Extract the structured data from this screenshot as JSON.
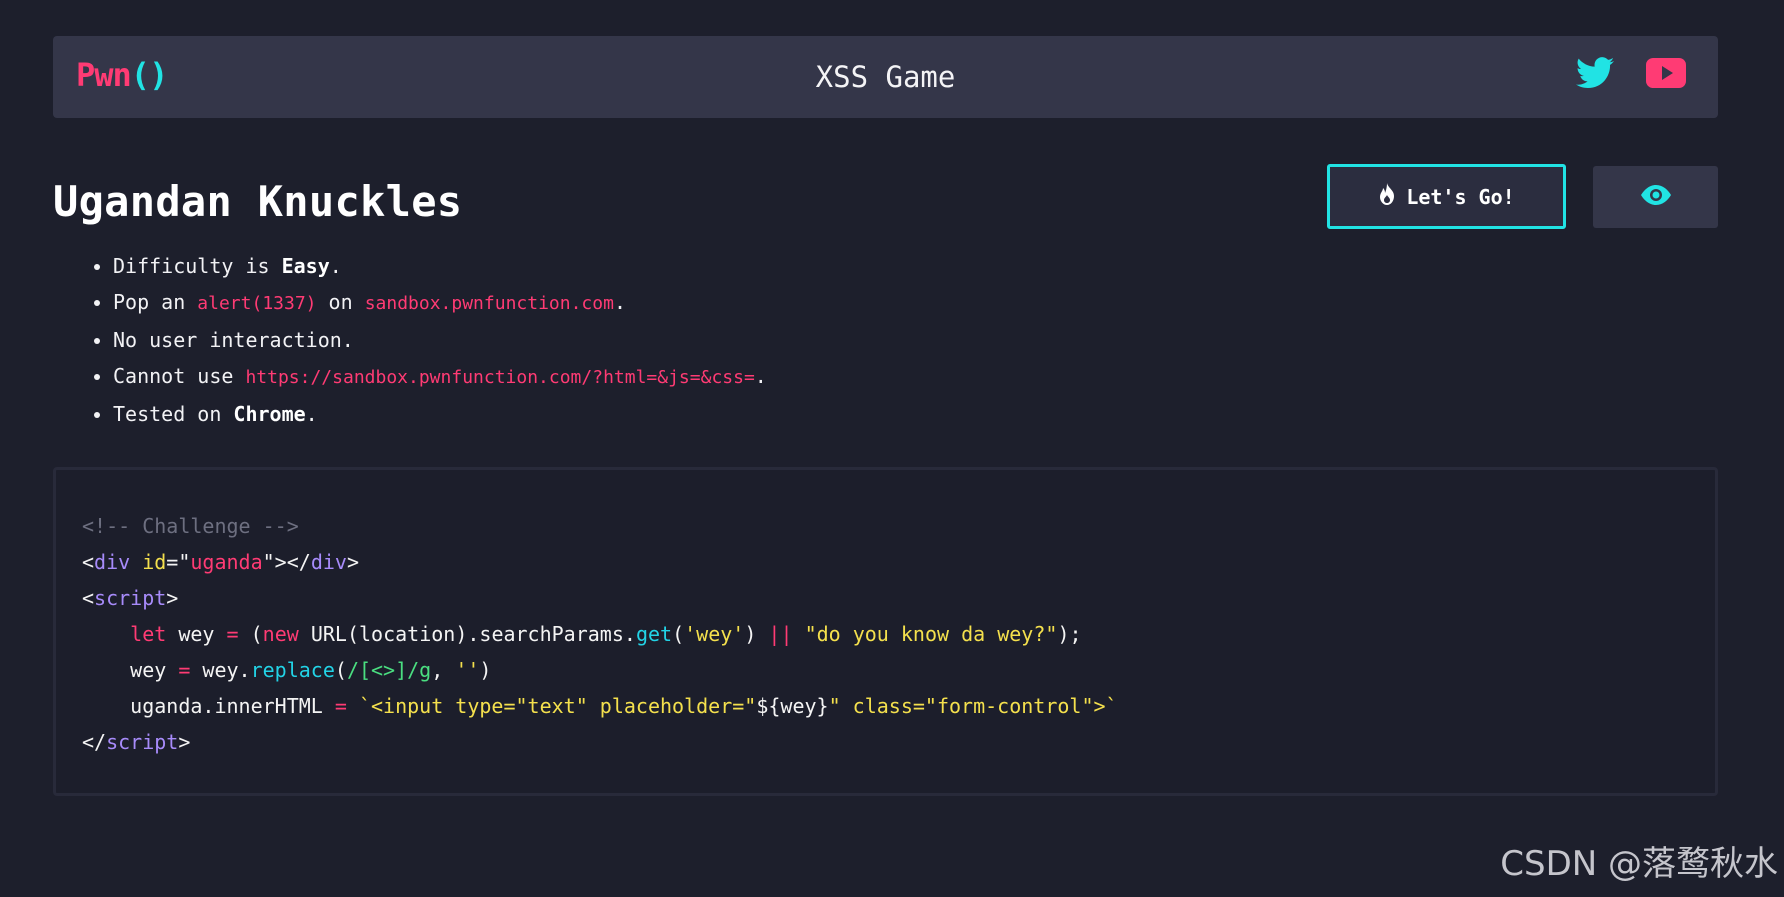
{
  "navbar": {
    "logo_text": "Pwn",
    "logo_parens": "()",
    "title": "XSS Game",
    "icons": [
      "twitter-icon",
      "youtube-icon"
    ],
    "accent_colors": {
      "pink": "#ff3b74",
      "cyan": "#21e3e4"
    }
  },
  "challenge": {
    "title": "Ugandan Knuckles",
    "go_button_label": "Let's Go!",
    "go_button_icon": "fire-icon",
    "view_button_icon": "eye-icon"
  },
  "rules": [
    {
      "prefix": "Difficulty is ",
      "bold": "Easy",
      "suffix": "."
    },
    {
      "prefix": "Pop an ",
      "code1": "alert(1337)",
      "mid": " on ",
      "code2": "sandbox.pwnfunction.com",
      "suffix": "."
    },
    {
      "prefix": "No user interaction.",
      "suffix": ""
    },
    {
      "prefix": "Cannot use ",
      "code1": "https://sandbox.pwnfunction.com/?html=&js=&css=",
      "suffix": "."
    },
    {
      "prefix": "Tested on ",
      "bold": "Chrome",
      "suffix": "."
    }
  ],
  "code": {
    "l1_comment": "<!-- Challenge -->",
    "l2_open": "<",
    "l2_tag": "div",
    "l2_attr": " id",
    "l2_eq": "=\"",
    "l2_val": "uganda",
    "l2_close": "\"></",
    "l2_tag2": "div",
    "l2_end": ">",
    "l3_open": "<",
    "l3_tag": "script",
    "l3_end": ">",
    "l4_indent": "    ",
    "l4_let": "let",
    "l4_a": " wey ",
    "l4_eq": "=",
    "l4_b": " (",
    "l4_new": "new",
    "l4_c": " URL(location).searchParams.",
    "l4_get": "get",
    "l4_d": "(",
    "l4_s1": "'wey'",
    "l4_e": ") ",
    "l4_or": "||",
    "l4_f": " ",
    "l4_s2": "\"do you know da wey?\"",
    "l4_g": ");",
    "l5_a": "    wey ",
    "l5_eq": "=",
    "l5_b": " wey.",
    "l5_fn": "replace",
    "l5_c": "(",
    "l5_rx": "/[<>]/g",
    "l5_d": ", ",
    "l5_s": "''",
    "l5_e": ")",
    "l6_a": "    uganda.innerHTML ",
    "l6_eq": "=",
    "l6_b": " ",
    "l6_s1": "`<input type=\"text\" placeholder=\"",
    "l6_tpl": "${wey}",
    "l6_s2": "\" class=\"form-control\">`",
    "l7_open": "</",
    "l7_tag": "script",
    "l7_end": ">"
  },
  "watermark": "CSDN @落鹜秋水"
}
